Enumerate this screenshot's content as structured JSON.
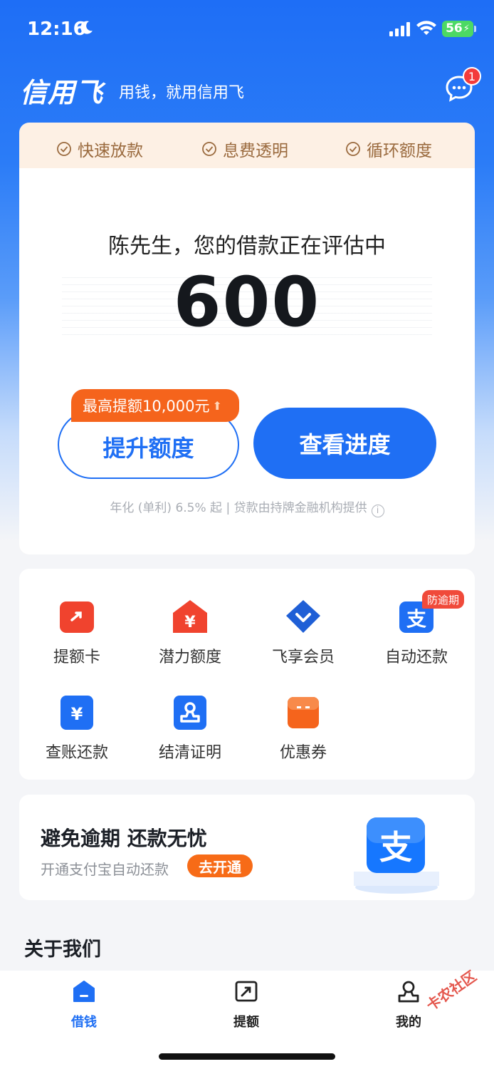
{
  "status_bar": {
    "time": "12:16",
    "battery": "56"
  },
  "header": {
    "logo": "信用飞",
    "slogan": "用钱，就用信用飞",
    "message_badge": "1"
  },
  "features": [
    "快速放款",
    "息费透明",
    "循环额度"
  ],
  "loan": {
    "status_text": "陈先生，您的借款正在评估中",
    "amount": "600",
    "raise_tag": "最高提额10,000元",
    "raise_button": "提升额度",
    "progress_button": "查看进度",
    "disclaimer": "年化 (单利) 6.5% 起 | 贷款由持牌金融机构提供"
  },
  "services": [
    {
      "label": "提额卡",
      "icon": "raise-card-icon",
      "color": "#f0432e"
    },
    {
      "label": "潜力额度",
      "icon": "yuan-house-icon",
      "color": "#f0432e"
    },
    {
      "label": "飞享会员",
      "icon": "diamond-member-icon",
      "color": "#1f5fd6"
    },
    {
      "label": "自动还款",
      "icon": "alipay-icon",
      "color": "#1f6ff4",
      "tag": "防逾期"
    },
    {
      "label": "查账还款",
      "icon": "yuan-bill-icon",
      "color": "#1f6ff4"
    },
    {
      "label": "结清证明",
      "icon": "stamp-icon",
      "color": "#1f6ff4"
    },
    {
      "label": "优惠券",
      "icon": "coupon-icon",
      "color": "#f5641c"
    }
  ],
  "promo": {
    "title": "避免逾期 还款无忧",
    "subtitle": "开通支付宝自动还款",
    "cta": "去开通"
  },
  "about_title": "关于我们",
  "tabs": [
    {
      "label": "借钱",
      "icon": "home-icon",
      "active": true
    },
    {
      "label": "提额",
      "icon": "raise-icon",
      "active": false
    },
    {
      "label": "我的",
      "icon": "person-icon",
      "active": false
    }
  ],
  "watermark": "卡农社区"
}
